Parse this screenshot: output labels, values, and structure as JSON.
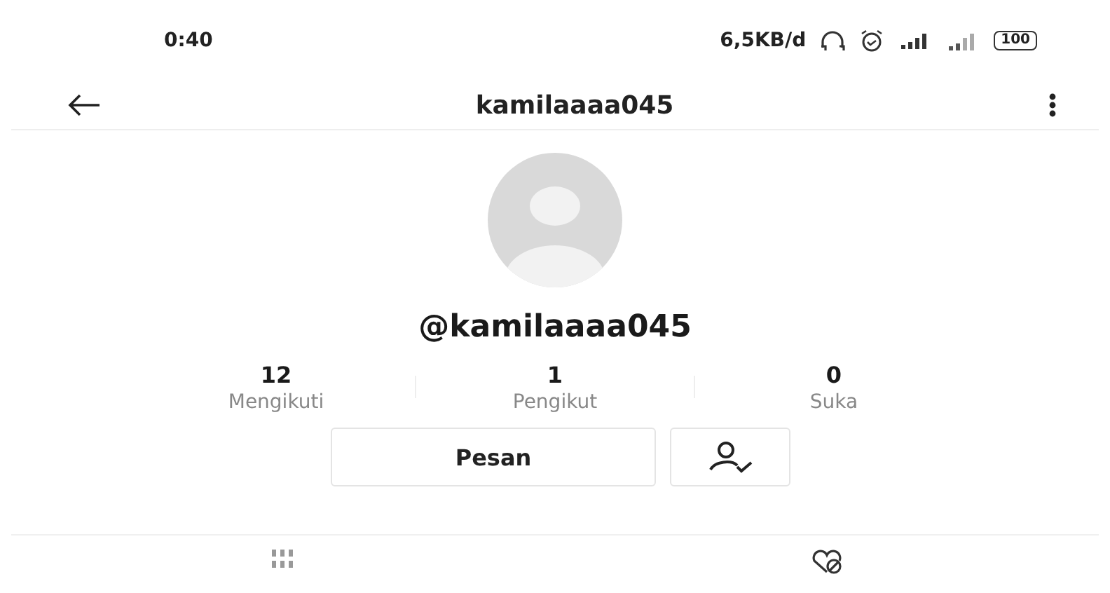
{
  "status_bar": {
    "time": "0:40",
    "speed": "6,5KB/d",
    "battery": "100"
  },
  "header": {
    "title": "kamilaaaa045"
  },
  "profile": {
    "username": "@kamilaaaa045"
  },
  "stats": [
    {
      "value": "12",
      "label": "Mengikuti"
    },
    {
      "value": "1",
      "label": "Pengikut"
    },
    {
      "value": "0",
      "label": "Suka"
    }
  ],
  "actions": {
    "message": "Pesan"
  }
}
